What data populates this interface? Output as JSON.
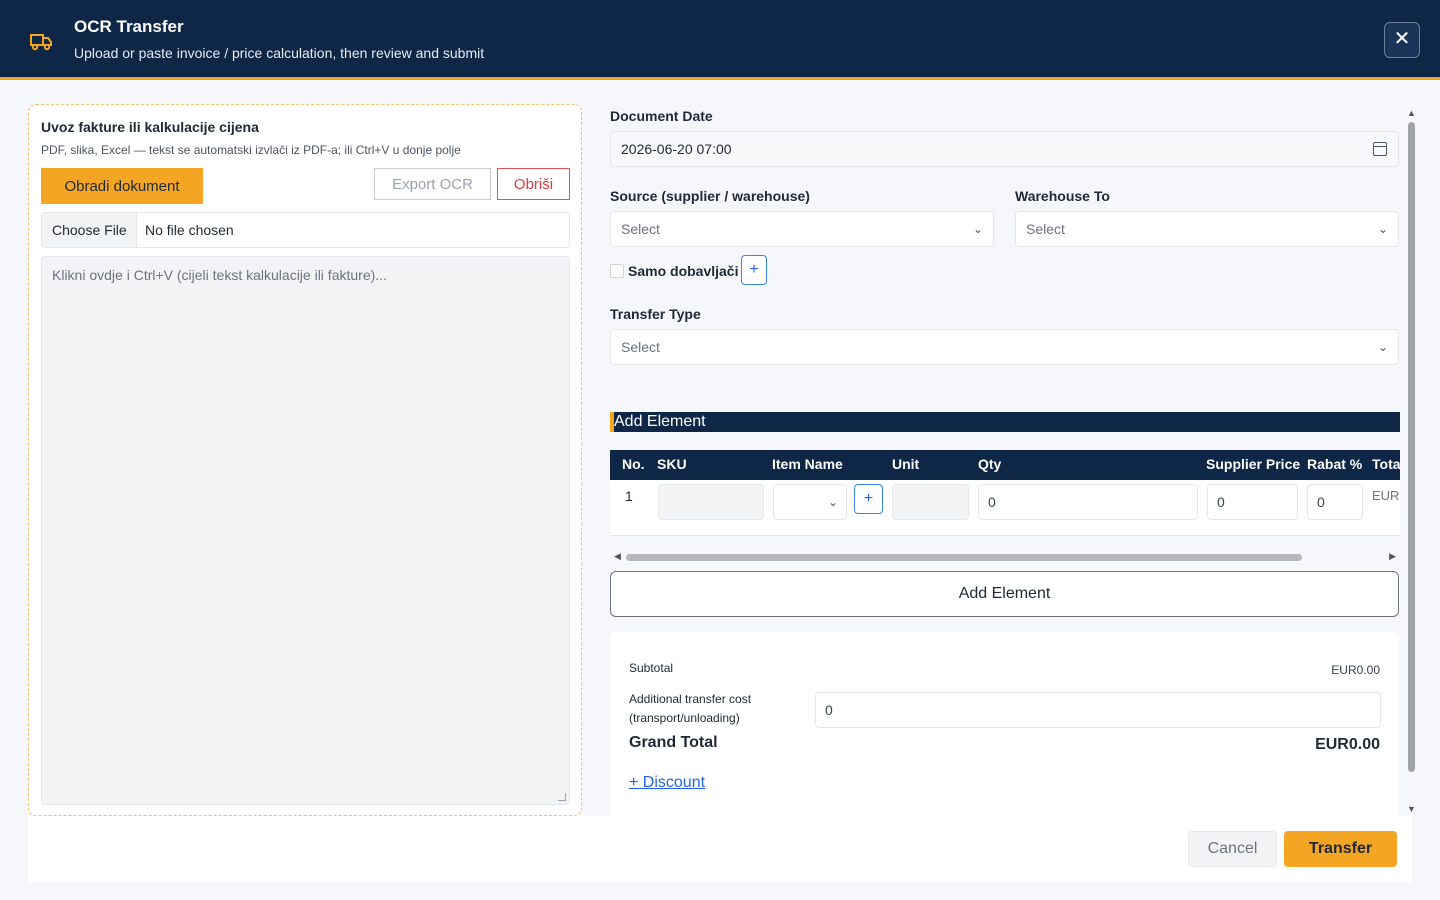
{
  "header": {
    "title": "OCR Transfer",
    "subtitle": "Upload or paste invoice / price calculation, then review and submit",
    "close_icon": "close-icon",
    "logo_icon": "truck-icon"
  },
  "import": {
    "title": "Uvoz fakture ili kalkulacije cijena",
    "subtitle": "PDF, slika, Excel — tekst se automatski izvlači iz PDF-a; ili Ctrl+V u donje polje",
    "process_label": "Obradi dokument",
    "export_label": "Export OCR",
    "delete_label": "Obriši",
    "choose_file_label": "Choose File",
    "no_file_label": "No file chosen",
    "paste_placeholder": "Klikni ovdje i Ctrl+V (cijeli tekst kalkulacije ili fakture)..."
  },
  "form": {
    "document_date_label": "Document Date",
    "document_date_value": "2026-06-20 07:00",
    "source_label": "Source (supplier / warehouse)",
    "source_value": "Select",
    "warehouse_to_label": "Warehouse To",
    "warehouse_to_value": "Select",
    "only_suppliers_label": "Samo dobavljači",
    "transfer_type_label": "Transfer Type",
    "transfer_type_value": "Select"
  },
  "elements": {
    "section_title": "Add Element",
    "columns": [
      "No.",
      "SKU",
      "Item Name",
      "Unit",
      "Qty",
      "Supplier Price",
      "Rabat %",
      "Tota"
    ],
    "rows": [
      {
        "no": "1",
        "sku": "",
        "item_name": "",
        "unit": "",
        "qty": "0",
        "supplier_price": "0",
        "rabat": "0",
        "total": "EUR"
      }
    ],
    "add_button_label": "Add Element"
  },
  "totals": {
    "subtotal_label": "Subtotal",
    "subtotal_value": "EUR0.00",
    "cost_label_line1": "Additional transfer cost",
    "cost_label_line2": "(transport/unloading)",
    "cost_value": "0",
    "grand_total_label": "Grand Total",
    "grand_total_value": "EUR0.00",
    "discount_link": "+ Discount"
  },
  "footer": {
    "cancel_label": "Cancel",
    "transfer_label": "Transfer"
  },
  "colors": {
    "header_bg": "#0f2746",
    "accent": "#f5a524",
    "danger": "#d83b45",
    "link": "#2563eb"
  }
}
